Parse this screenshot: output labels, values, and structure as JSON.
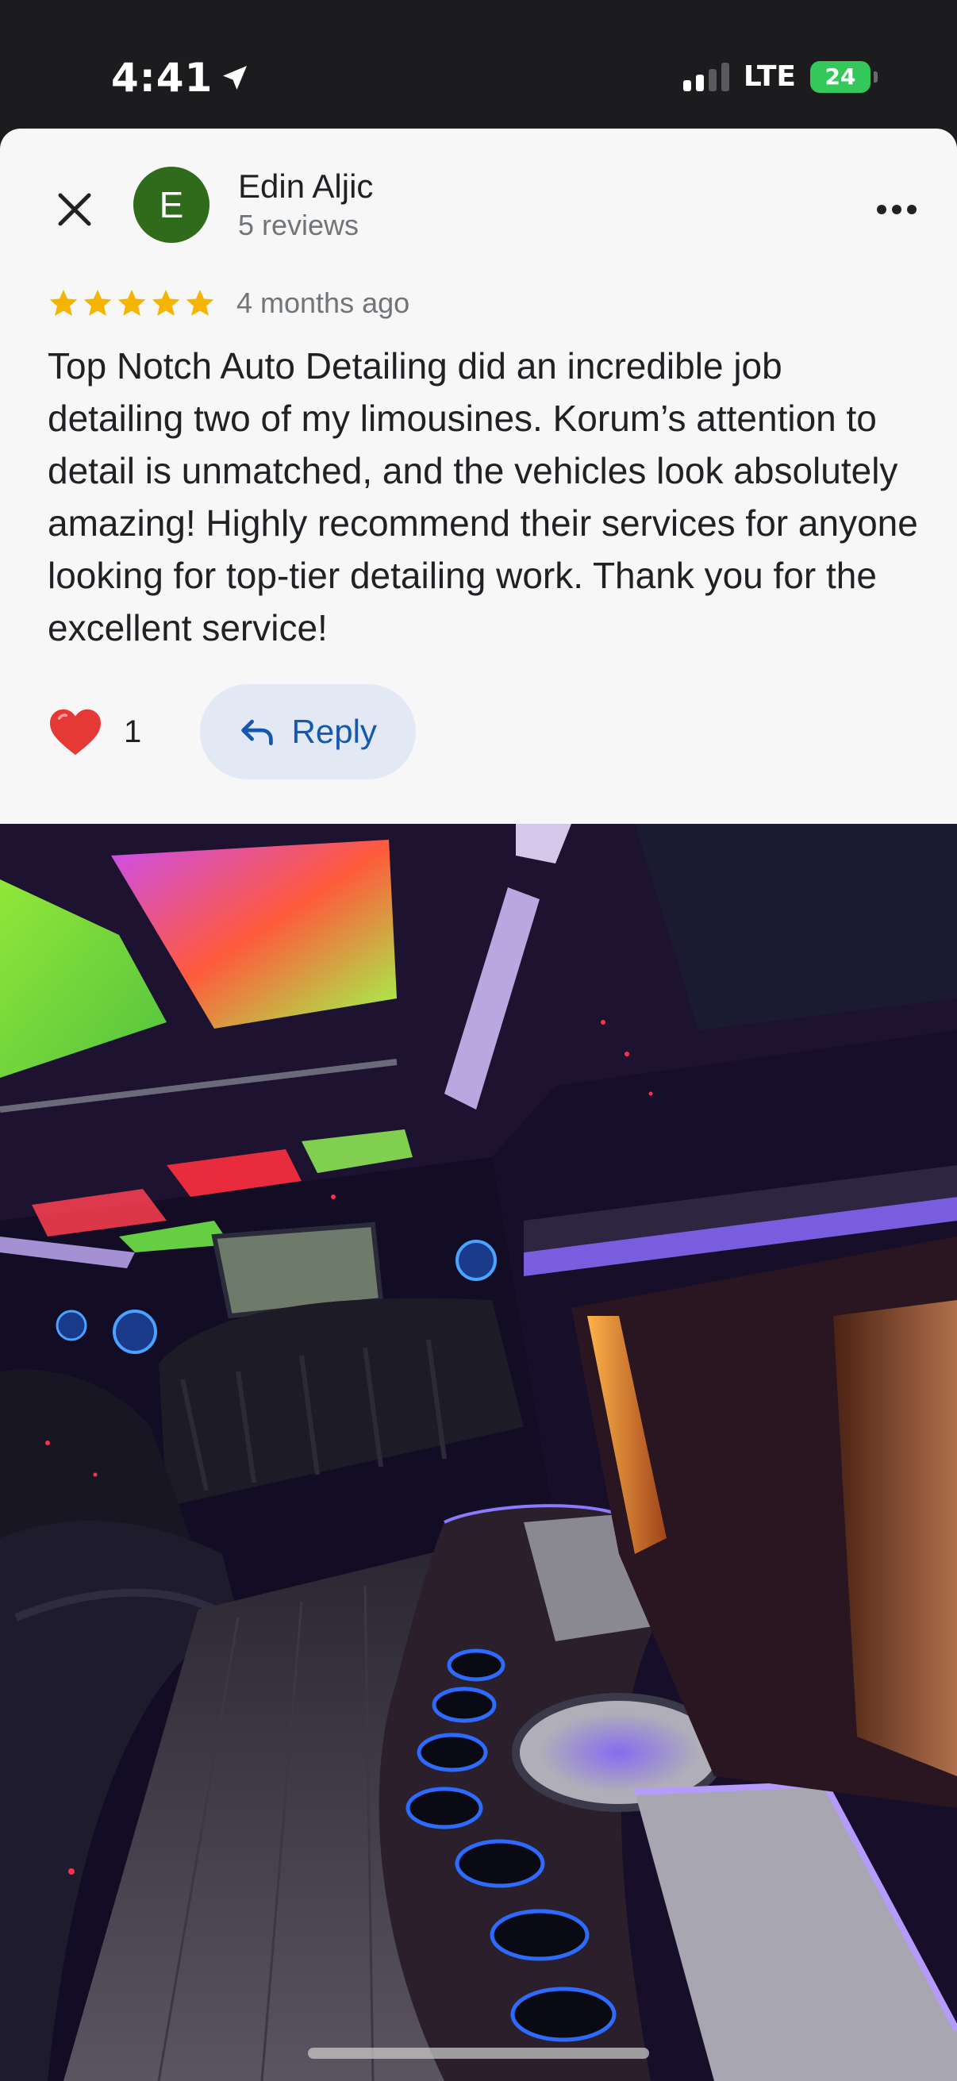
{
  "status_bar": {
    "time": "4:41",
    "network": "LTE",
    "battery": "24"
  },
  "review": {
    "reviewer": {
      "initial": "E",
      "name": "Edin Aljic",
      "review_count": "5 reviews",
      "avatar_color": "#2f6b1a"
    },
    "rating": 5,
    "date": "4 months ago",
    "text": "Top Notch Auto Detailing did an incredible job detailing two of my limousines. Korum’s attention to detail is unmatched, and the vehicles look absolutely amazing! Highly recommend their services for anyone looking for top-tier detailing work. Thank you for the excellent service!",
    "likes": "1",
    "reply_label": "Reply"
  },
  "colors": {
    "star": "#f4b400",
    "heart": "#e53935",
    "reply_accent": "#1558b0",
    "reply_bg": "#e3e9f4",
    "battery": "#34c759"
  },
  "icons": [
    "location-arrow-icon",
    "close-icon",
    "more-options-icon",
    "star-icon",
    "heart-icon",
    "reply-arrow-icon"
  ]
}
